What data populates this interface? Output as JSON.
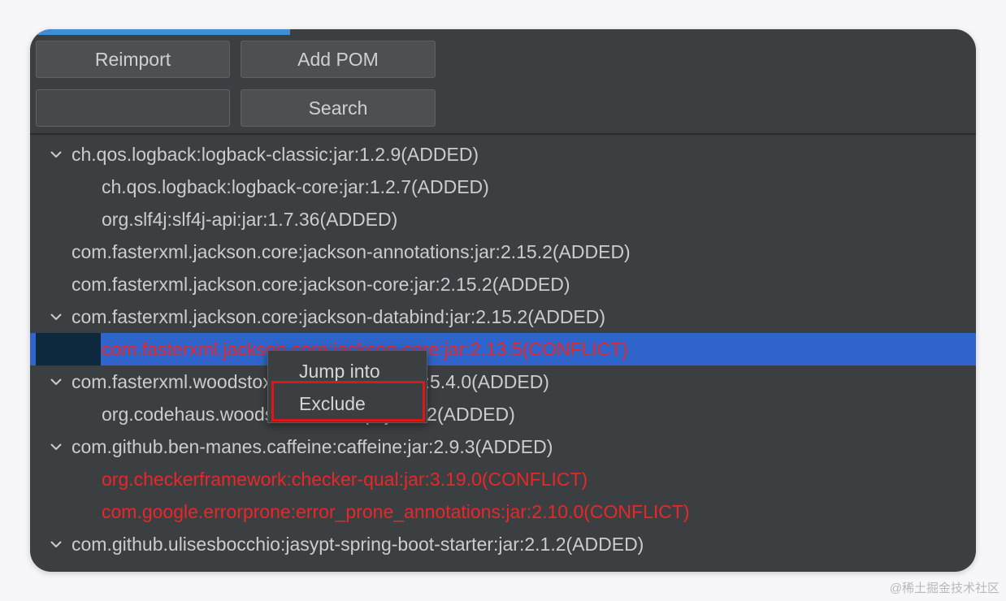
{
  "toolbar": {
    "reimport_label": "Reimport",
    "add_pom_label": "Add POM",
    "search_label": "Search",
    "search_value": ""
  },
  "progress": {
    "fraction": 0.275,
    "color": "#3d8fd8"
  },
  "tree": {
    "rows": [
      {
        "text": "ch.qos.logback:logback-classic:jar:1.2.9(ADDED)",
        "level": 0,
        "expanded": true,
        "status": "added"
      },
      {
        "text": "ch.qos.logback:logback-core:jar:1.2.7(ADDED)",
        "level": 1,
        "status": "added"
      },
      {
        "text": "org.slf4j:slf4j-api:jar:1.7.36(ADDED)",
        "level": 1,
        "status": "added"
      },
      {
        "text": "com.fasterxml.jackson.core:jackson-annotations:jar:2.15.2(ADDED)",
        "level": 0,
        "status": "added"
      },
      {
        "text": "com.fasterxml.jackson.core:jackson-core:jar:2.15.2(ADDED)",
        "level": 0,
        "status": "added"
      },
      {
        "text": "com.fasterxml.jackson.core:jackson-databind:jar:2.15.2(ADDED)",
        "level": 0,
        "expanded": true,
        "status": "added"
      },
      {
        "text": "com.fasterxml.jackson.core:jackson-core:jar:2.13.5(CONFLICT)",
        "level": 1,
        "status": "conflict",
        "selected": true
      },
      {
        "text": "com.fasterxml.woodstox:woodstox-core:jar:5.4.0(ADDED)",
        "level": 0,
        "expanded": true,
        "status": "added"
      },
      {
        "text": "org.codehaus.woodstox:stax2-api:jar:4.2(ADDED)",
        "level": 1,
        "status": "added"
      },
      {
        "text": "com.github.ben-manes.caffeine:caffeine:jar:2.9.3(ADDED)",
        "level": 0,
        "expanded": true,
        "status": "added"
      },
      {
        "text": "org.checkerframework:checker-qual:jar:3.19.0(CONFLICT)",
        "level": 1,
        "status": "conflict"
      },
      {
        "text": "com.google.errorprone:error_prone_annotations:jar:2.10.0(CONFLICT)",
        "level": 1,
        "status": "conflict"
      },
      {
        "text": "com.github.ulisesbocchio:jasypt-spring-boot-starter:jar:2.1.2(ADDED)",
        "level": 0,
        "expanded": true,
        "status": "added"
      }
    ]
  },
  "context_menu": {
    "items": [
      {
        "label": "Jump into"
      },
      {
        "label": "Exclude",
        "highlighted": true
      }
    ]
  },
  "colors": {
    "panel_bg": "#3c3f41",
    "selection": "#2f65ca",
    "conflict_text": "#e82727",
    "normal_text": "#cccccc",
    "annotation_box": "#e01616"
  },
  "icons": {
    "expand": "chevron-down-icon"
  },
  "watermark": "@稀土掘金技术社区"
}
